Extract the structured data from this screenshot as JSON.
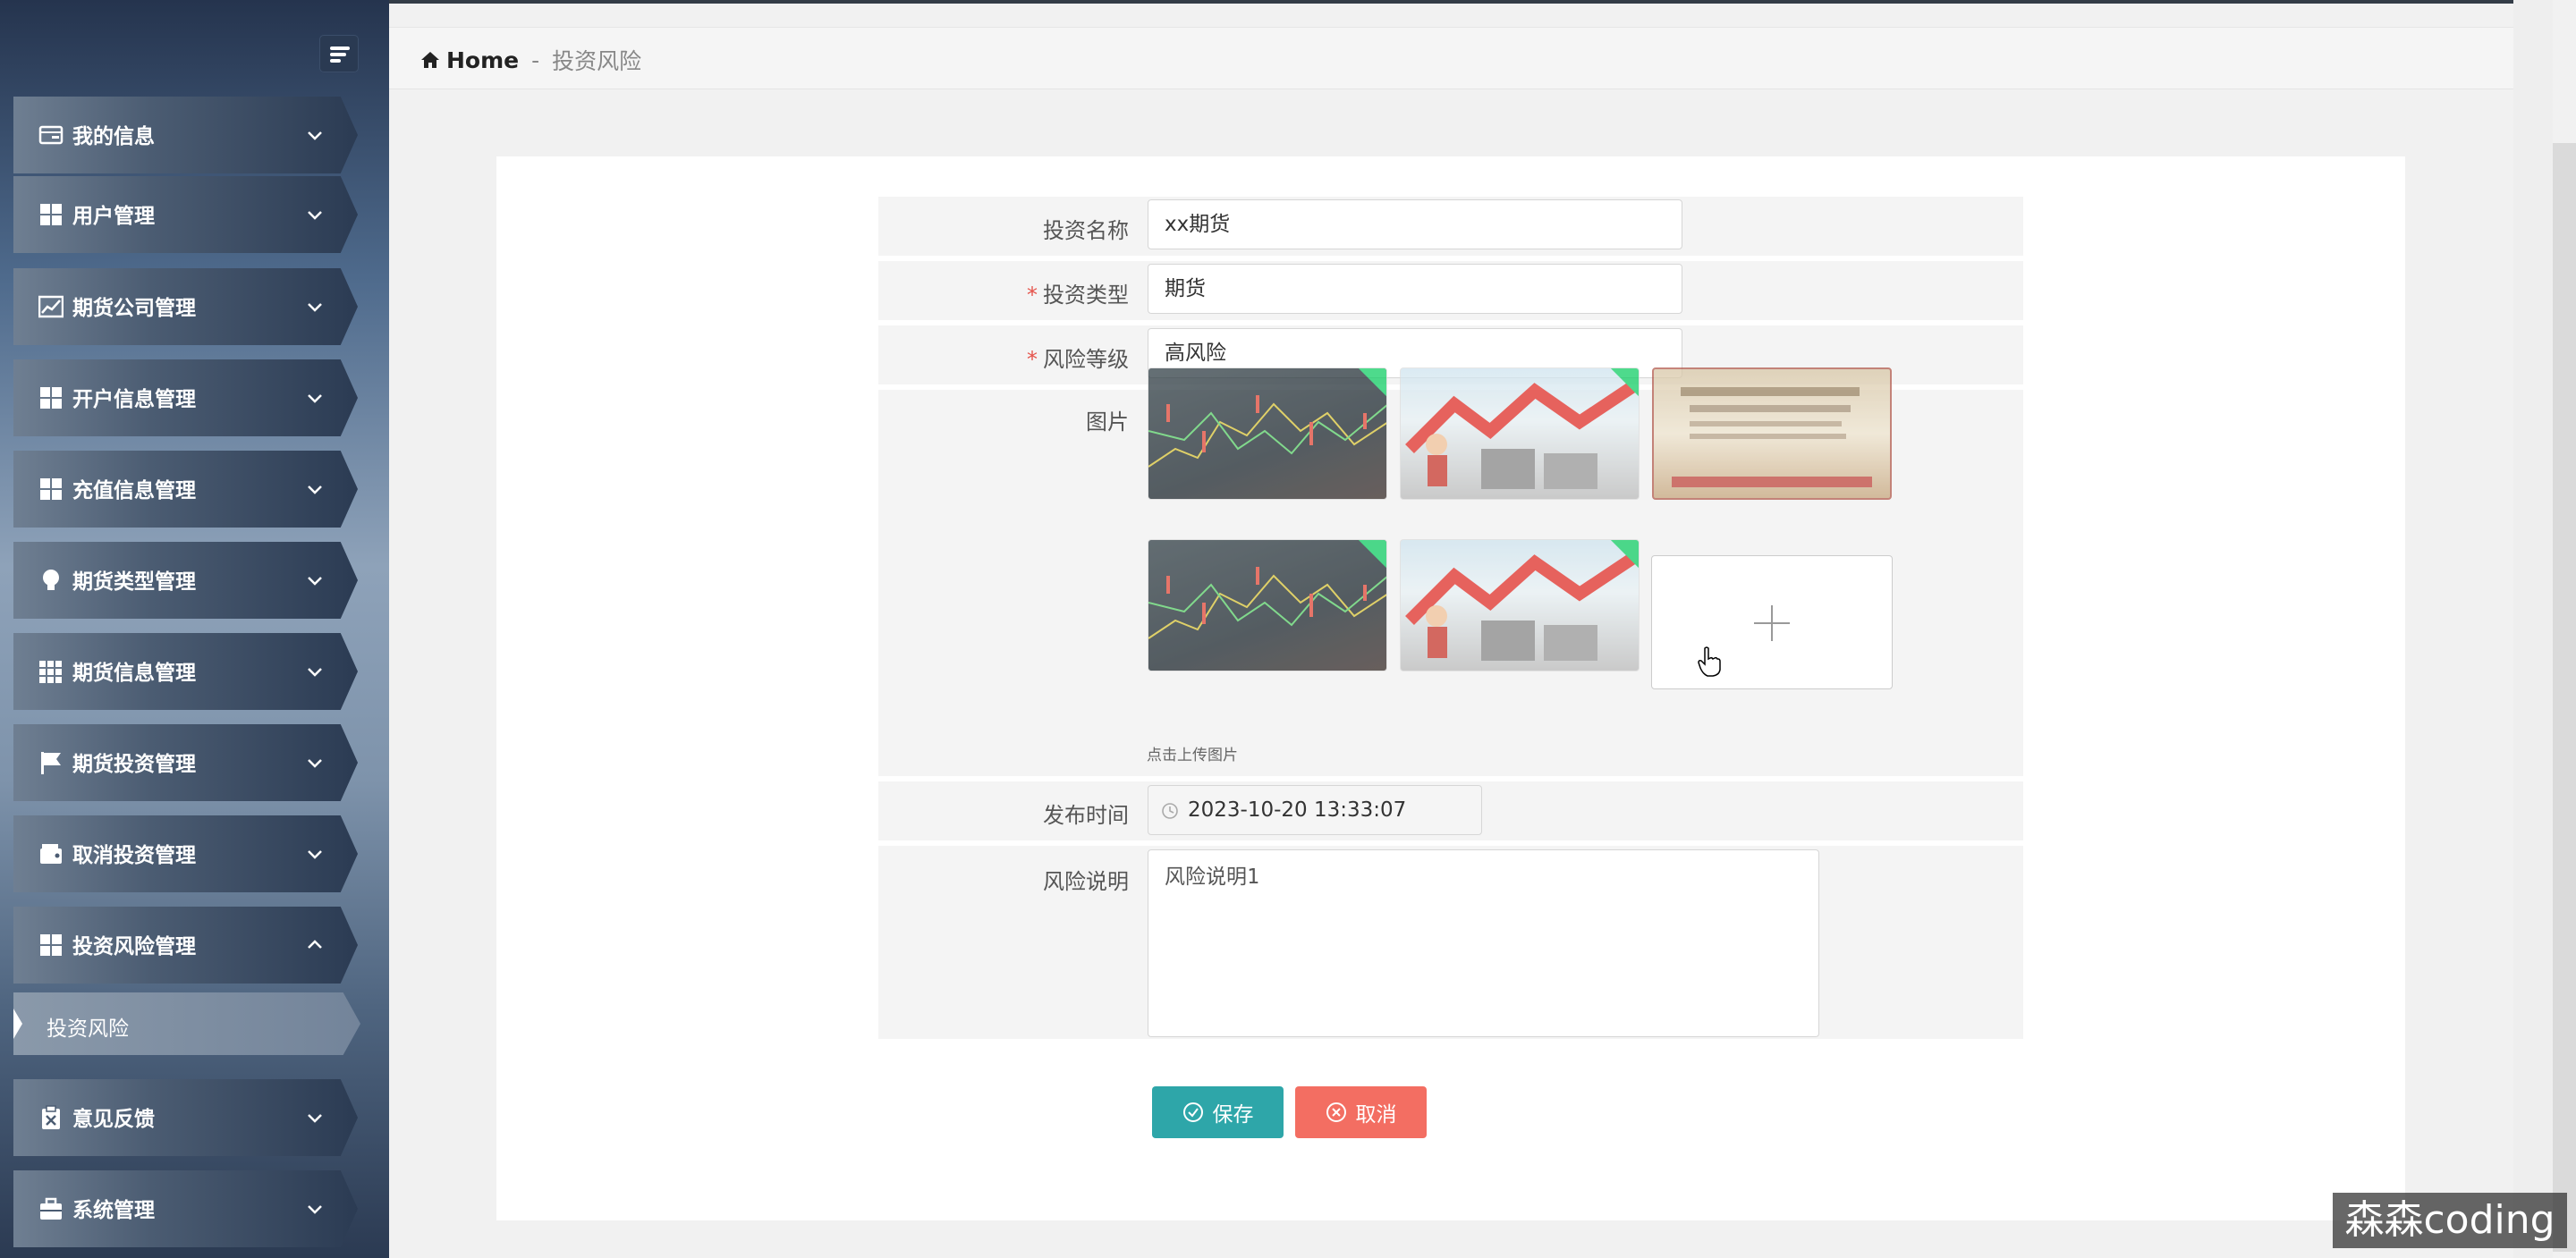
{
  "sidebar": {
    "items": [
      {
        "label": "我的信息",
        "icon": "card-icon"
      },
      {
        "label": "用户管理",
        "icon": "grid-icon"
      },
      {
        "label": "期货公司管理",
        "icon": "chart-icon"
      },
      {
        "label": "开户信息管理",
        "icon": "grid-icon"
      },
      {
        "label": "充值信息管理",
        "icon": "grid-icon"
      },
      {
        "label": "期货类型管理",
        "icon": "bulb-icon"
      },
      {
        "label": "期货信息管理",
        "icon": "table-icon"
      },
      {
        "label": "期货投资管理",
        "icon": "flag-icon"
      },
      {
        "label": "取消投资管理",
        "icon": "wallet-icon"
      },
      {
        "label": "投资风险管理",
        "icon": "grid-icon"
      },
      {
        "label": "意见反馈",
        "icon": "clipboard-icon"
      },
      {
        "label": "系统管理",
        "icon": "briefcase-icon"
      }
    ],
    "sub_item": "投资风险"
  },
  "breadcrumb": {
    "home": "Home",
    "sep": "-",
    "current": "投资风险"
  },
  "form": {
    "name_label": "投资名称",
    "name_value": "xx期货",
    "type_label": "投资类型",
    "type_value": "期货",
    "risk_label": "风险等级",
    "risk_value": "高风险",
    "image_label": "图片",
    "upload_hint": "点击上传图片",
    "time_label": "发布时间",
    "time_value": "2023-10-20 13:33:07",
    "desc_label": "风险说明",
    "desc_value": "风险说明1",
    "required_mark": "*"
  },
  "buttons": {
    "save": "保存",
    "cancel": "取消"
  },
  "watermark": "森森coding",
  "colors": {
    "save": "#2ea6a9",
    "cancel": "#f36e62",
    "required": "#e5534b",
    "upload_corner": "#13ce66"
  }
}
